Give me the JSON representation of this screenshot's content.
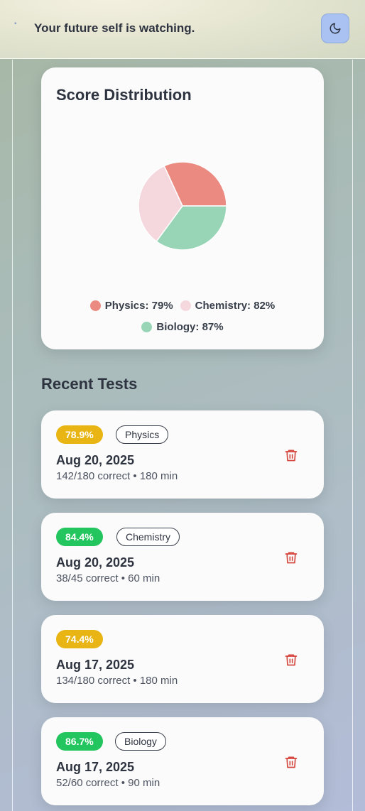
{
  "header": {
    "tagline": "Your future self is watching.",
    "theme_icon": "moon-icon"
  },
  "score_distribution": {
    "title": "Score Distribution",
    "legend": [
      {
        "label": "Physics: 79%",
        "color": "#ea8a80"
      },
      {
        "label": "Chemistry: 82%",
        "color": "#f5d7de"
      },
      {
        "label": "Biology: 87%",
        "color": "#98d4b6"
      }
    ]
  },
  "chart_data": {
    "type": "pie",
    "title": "Score Distribution",
    "categories": [
      "Physics",
      "Chemistry",
      "Biology"
    ],
    "values": [
      79,
      82,
      87
    ],
    "colors": [
      "#ea8a80",
      "#f5d7de",
      "#98d4b6"
    ],
    "legend": "bottom"
  },
  "recent_tests": {
    "title": "Recent Tests",
    "items": [
      {
        "percent": "78.9%",
        "percent_color": "#e8b514",
        "subject": "Physics",
        "date": "Aug 20, 2025",
        "meta": "142/180 correct • 180 min"
      },
      {
        "percent": "84.4%",
        "percent_color": "#22c55e",
        "subject": "Chemistry",
        "date": "Aug 20, 2025",
        "meta": "38/45 correct • 60 min"
      },
      {
        "percent": "74.4%",
        "percent_color": "#e8b514",
        "subject": "",
        "date": "Aug 17, 2025",
        "meta": "134/180 correct • 180 min"
      },
      {
        "percent": "86.7%",
        "percent_color": "#22c55e",
        "subject": "Biology",
        "date": "Aug 17, 2025",
        "meta": "52/60 correct • 90 min"
      }
    ]
  }
}
